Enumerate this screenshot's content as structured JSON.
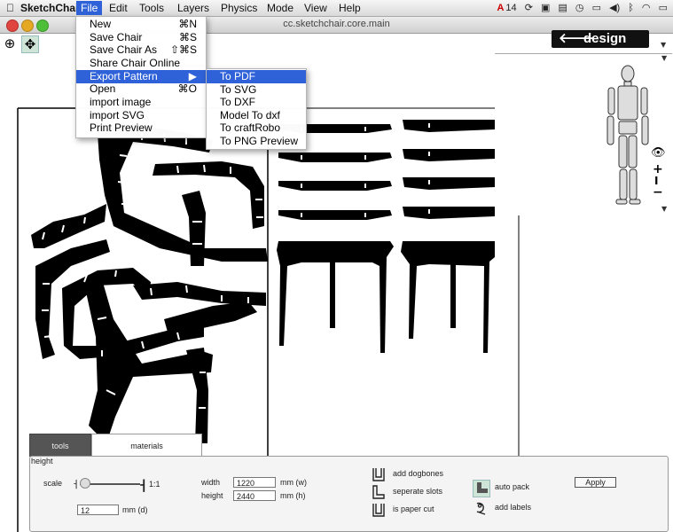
{
  "menubar": {
    "app_name": "SketchChair",
    "items": [
      "File",
      "Edit",
      "Tools",
      "Layers",
      "Physics",
      "Mode",
      "View",
      "Help"
    ],
    "active": "File",
    "status": {
      "adobe_count": "14"
    }
  },
  "window": {
    "title": "cc.sketchchair.core.main"
  },
  "toolbar": {
    "design_label": "design",
    "design_arrow": "🡐"
  },
  "file_menu": [
    {
      "label": "New",
      "shortcut": "⌘N"
    },
    {
      "label": "Save Chair",
      "shortcut": "⌘S"
    },
    {
      "label": "Save Chair As",
      "shortcut": "⇧⌘S"
    },
    {
      "label": "Share Chair Online",
      "shortcut": ""
    },
    {
      "label": "Export Pattern",
      "shortcut": "▶"
    },
    {
      "label": "Open",
      "shortcut": "⌘O"
    },
    {
      "label": "import image",
      "shortcut": ""
    },
    {
      "label": "import SVG",
      "shortcut": ""
    },
    {
      "label": "Print Preview",
      "shortcut": ""
    }
  ],
  "export_menu": [
    "To PDF",
    "To SVG",
    "To DXF",
    "Model To dxf",
    "To craftRobo",
    "To PNG Preview"
  ],
  "tabs": {
    "tools": "tools",
    "materials": "materials"
  },
  "panel": {
    "height_label": "height",
    "scale_label": "scale",
    "scale_ratio": "1:1",
    "thickness_value": "12",
    "thickness_unit": "mm (d)",
    "width_label": "width",
    "width_value": "1220",
    "width_unit": "mm (w)",
    "height2_label": "height",
    "height_value": "2440",
    "height_unit": "mm (h)",
    "add_dogbones": "add dogbones",
    "separate_slots": "seperate slots",
    "paper_cut": "is paper cut",
    "auto_pack": "auto pack",
    "add_labels": "add labels",
    "apply": "Apply"
  },
  "colors": {
    "accent": "#2f62d8",
    "design_bg": "#111111",
    "tab_active": "#555555"
  }
}
